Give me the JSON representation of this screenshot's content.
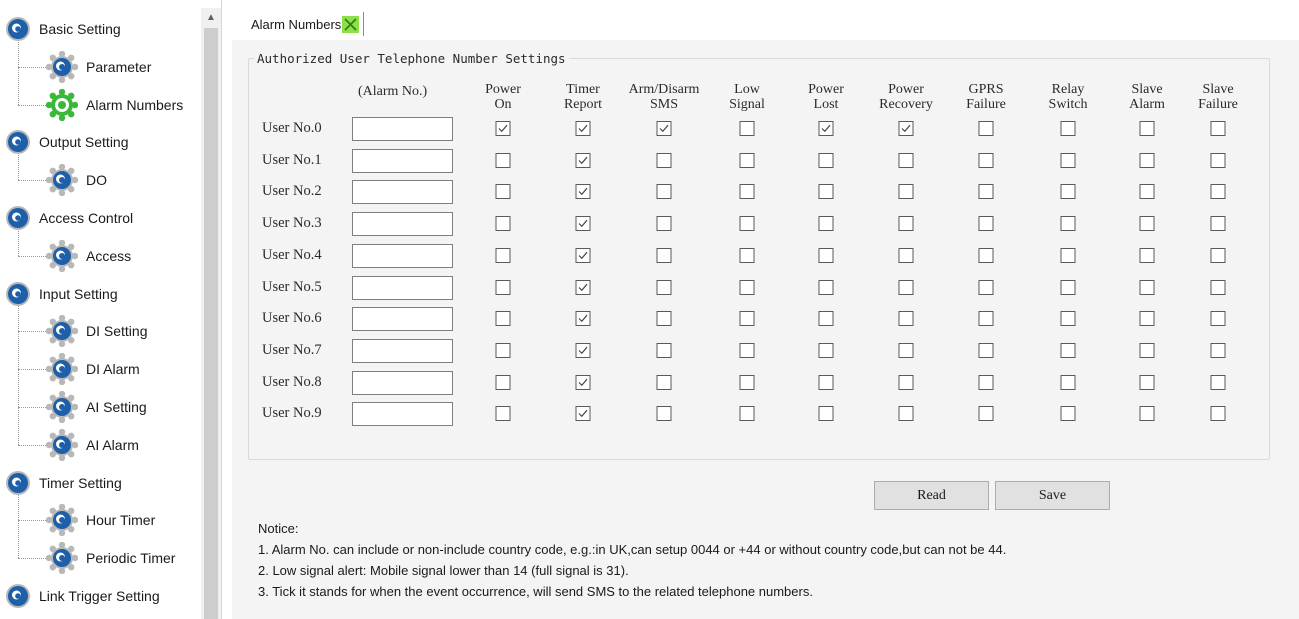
{
  "sidebar": {
    "items": [
      {
        "label": "Basic Setting",
        "level": 0,
        "icon": "gear-root-icon"
      },
      {
        "label": "Parameter",
        "level": 1,
        "icon": "gear-icon"
      },
      {
        "label": "Alarm Numbers",
        "level": 1,
        "icon": "gear-selected-icon",
        "selected": true
      },
      {
        "label": "Output Setting",
        "level": 0,
        "icon": "gear-root-icon"
      },
      {
        "label": "DO",
        "level": 1,
        "icon": "gear-icon"
      },
      {
        "label": "Access Control",
        "level": 0,
        "icon": "gear-root-icon"
      },
      {
        "label": "Access",
        "level": 1,
        "icon": "gear-icon"
      },
      {
        "label": "Input Setting",
        "level": 0,
        "icon": "gear-root-icon"
      },
      {
        "label": "DI Setting",
        "level": 1,
        "icon": "gear-icon"
      },
      {
        "label": "DI Alarm",
        "level": 1,
        "icon": "gear-icon"
      },
      {
        "label": "AI  Setting",
        "level": 1,
        "icon": "gear-icon"
      },
      {
        "label": "AI Alarm",
        "level": 1,
        "icon": "gear-icon"
      },
      {
        "label": "Timer Setting",
        "level": 0,
        "icon": "gear-root-icon"
      },
      {
        "label": "Hour Timer",
        "level": 1,
        "icon": "gear-icon"
      },
      {
        "label": "Periodic Timer",
        "level": 1,
        "icon": "gear-icon"
      },
      {
        "label": "Link Trigger Setting",
        "level": 0,
        "icon": "gear-root-icon"
      }
    ],
    "scroll_up": "▲"
  },
  "tab": {
    "label": "Alarm Numbers",
    "close_icon": "close-x-icon"
  },
  "group": {
    "title": "Authorized User Telephone Number Settings"
  },
  "table": {
    "alarm_col_header": "(Alarm No.)",
    "columns": [
      [
        "Power",
        "On"
      ],
      [
        "Timer",
        "Report"
      ],
      [
        "Arm/Disarm",
        "SMS"
      ],
      [
        "Low",
        "Signal"
      ],
      [
        "Power",
        "Lost"
      ],
      [
        "Power",
        "Recovery"
      ],
      [
        "GPRS",
        "Failure"
      ],
      [
        "Relay",
        "Switch"
      ],
      [
        "Slave",
        "Alarm"
      ],
      [
        "Slave",
        "Failure"
      ]
    ],
    "rows": [
      {
        "label": "User No.0",
        "alarm_no": "",
        "checks": [
          true,
          true,
          true,
          false,
          true,
          true,
          false,
          false,
          false,
          false
        ]
      },
      {
        "label": "User No.1",
        "alarm_no": "",
        "checks": [
          false,
          true,
          false,
          false,
          false,
          false,
          false,
          false,
          false,
          false
        ]
      },
      {
        "label": "User No.2",
        "alarm_no": "",
        "checks": [
          false,
          true,
          false,
          false,
          false,
          false,
          false,
          false,
          false,
          false
        ]
      },
      {
        "label": "User No.3",
        "alarm_no": "",
        "checks": [
          false,
          true,
          false,
          false,
          false,
          false,
          false,
          false,
          false,
          false
        ]
      },
      {
        "label": "User No.4",
        "alarm_no": "",
        "checks": [
          false,
          true,
          false,
          false,
          false,
          false,
          false,
          false,
          false,
          false
        ]
      },
      {
        "label": "User No.5",
        "alarm_no": "",
        "checks": [
          false,
          true,
          false,
          false,
          false,
          false,
          false,
          false,
          false,
          false
        ]
      },
      {
        "label": "User No.6",
        "alarm_no": "",
        "checks": [
          false,
          true,
          false,
          false,
          false,
          false,
          false,
          false,
          false,
          false
        ]
      },
      {
        "label": "User No.7",
        "alarm_no": "",
        "checks": [
          false,
          true,
          false,
          false,
          false,
          false,
          false,
          false,
          false,
          false
        ]
      },
      {
        "label": "User No.8",
        "alarm_no": "",
        "checks": [
          false,
          true,
          false,
          false,
          false,
          false,
          false,
          false,
          false,
          false
        ]
      },
      {
        "label": "User No.9",
        "alarm_no": "",
        "checks": [
          false,
          true,
          false,
          false,
          false,
          false,
          false,
          false,
          false,
          false
        ]
      }
    ]
  },
  "buttons": {
    "read": "Read",
    "save": "Save"
  },
  "notice": {
    "title": "Notice:",
    "lines": [
      "1. Alarm No. can include or non-include country code, e.g.:in UK,can setup 0044 or +44 or without country code,but can not be 44.",
      "2. Low signal alert: Mobile signal lower than 14 (full signal is 31).",
      "3. Tick it stands for when the event occurrence, will send SMS to the related telephone numbers."
    ]
  },
  "colors": {
    "icon_blue": "#1d5fa8",
    "icon_gear": "#b8b8b8",
    "icon_selected_green": "#3ab83a",
    "tab_close_bg": "#8ee04a",
    "panel_bg": "#f4f4f4"
  }
}
